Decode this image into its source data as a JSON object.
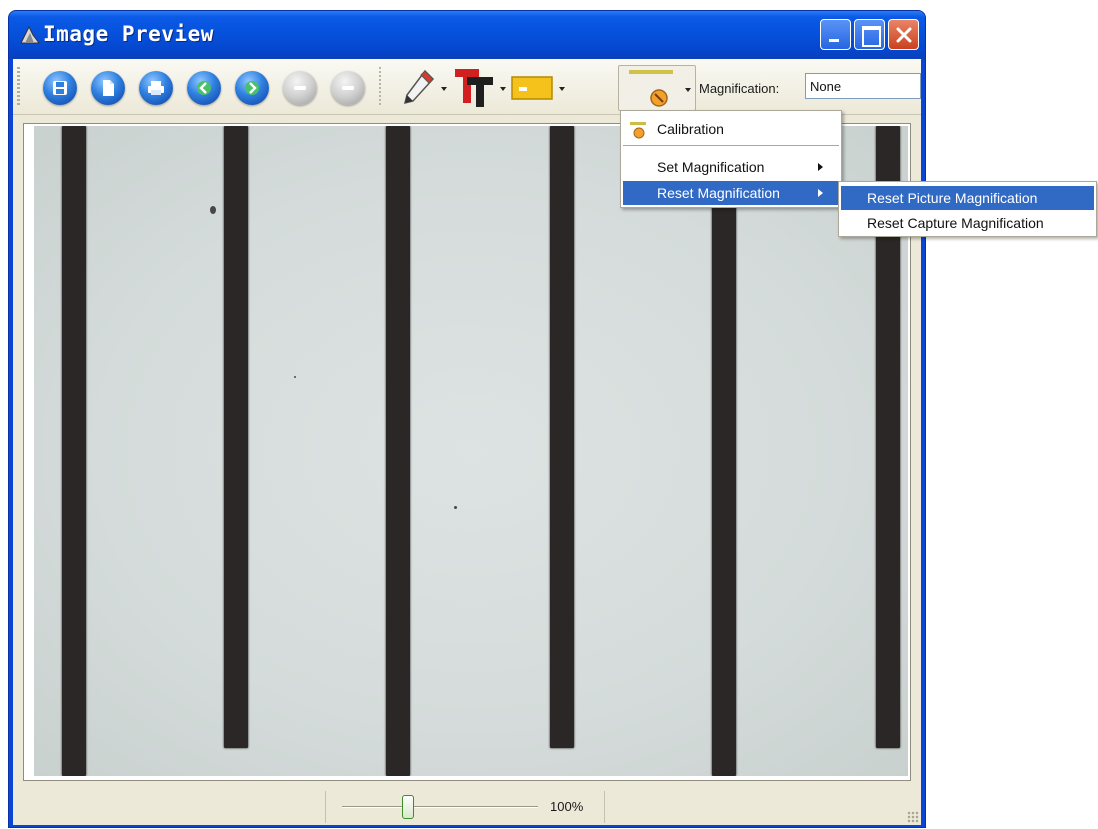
{
  "window": {
    "title": "Image Preview"
  },
  "toolbar": {
    "buttons": [
      {
        "icon": "save-icon"
      },
      {
        "icon": "new-document-icon"
      },
      {
        "icon": "print-icon"
      },
      {
        "icon": "previous-icon"
      },
      {
        "icon": "next-icon"
      },
      {
        "icon": "zoom-out-icon"
      },
      {
        "icon": "zoom-in-icon"
      }
    ],
    "tools": [
      "pencil-icon",
      "text-icon",
      "rectangle-icon",
      "measure-icon"
    ],
    "magnification_label": "Magnification:",
    "magnification_value": "None"
  },
  "menu": {
    "items": [
      {
        "label": "Calibration",
        "icon": "calibration-icon"
      },
      {
        "label": "Set Magnification",
        "submenu": true
      },
      {
        "label": "Reset Magnification",
        "submenu": true,
        "highlighted": true
      }
    ],
    "submenu": [
      {
        "label": "Reset Picture Magnification",
        "highlighted": true
      },
      {
        "label": "Reset Capture Magnification"
      }
    ]
  },
  "status": {
    "zoom_value": 1.0,
    "zoom_text": "100%"
  },
  "colors": {
    "title_bar": "#0653de",
    "menu_highlight": "#316ac5",
    "client_bg": "#ece9d8"
  }
}
